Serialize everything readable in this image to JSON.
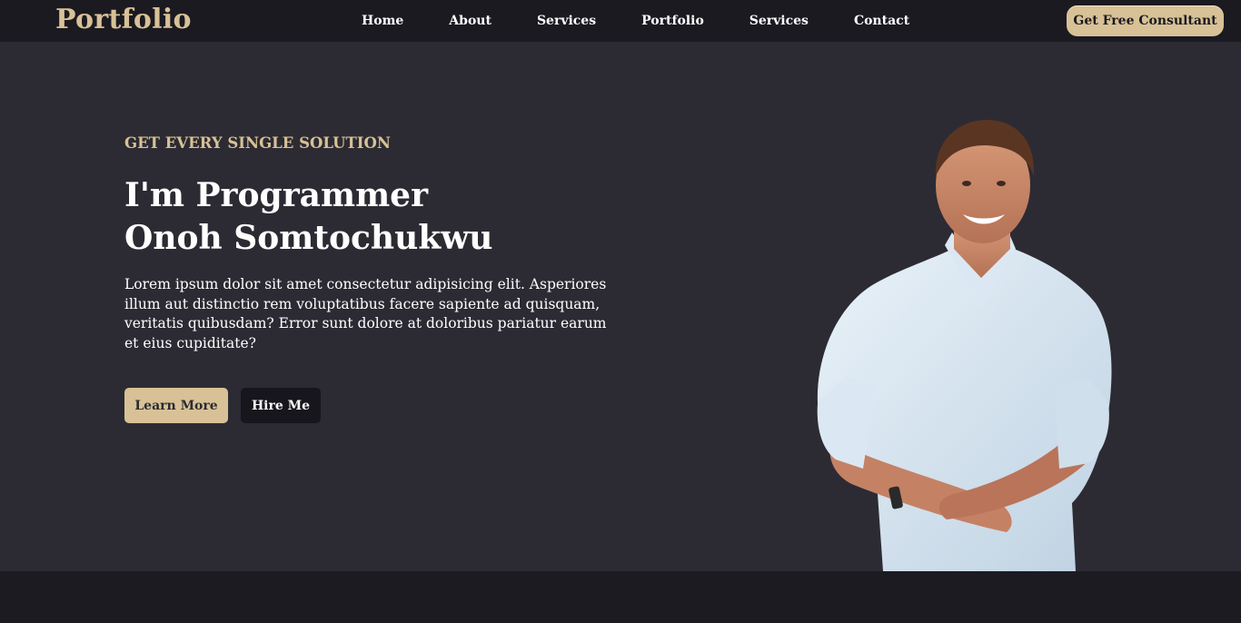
{
  "brand": {
    "logo": "Portfolio",
    "accent": "#d8c196"
  },
  "nav": {
    "links": [
      "Home",
      "About",
      "Services",
      "Portfolio",
      "Services",
      "Contact"
    ],
    "cta": "Get Free Consultant"
  },
  "hero": {
    "eyebrow": "GET EVERY SINGLE SOLUTION",
    "headline_line1": "I'm Programmer",
    "headline_line2": "Onoh Somtochukwu",
    "intro": "Lorem ipsum dolor sit amet consectetur adipisicing elit. Asperiores illum aut distinctio rem voluptatibus facere sapiente ad quisquam, veritatis quibusdam? Error sunt dolore at doloribus pariatur earum et eius cupiditate?",
    "buttons": {
      "learn_more": "Learn More",
      "hire_me": "Hire Me"
    },
    "image": "smiling-man-crossed-arms-photo"
  },
  "colors": {
    "navbar_bg": "#1b1a21",
    "hero_bg": "#2c2b33",
    "footer_bg": "#1c1b22",
    "accent": "#d8c196",
    "text": "#ffffff"
  }
}
